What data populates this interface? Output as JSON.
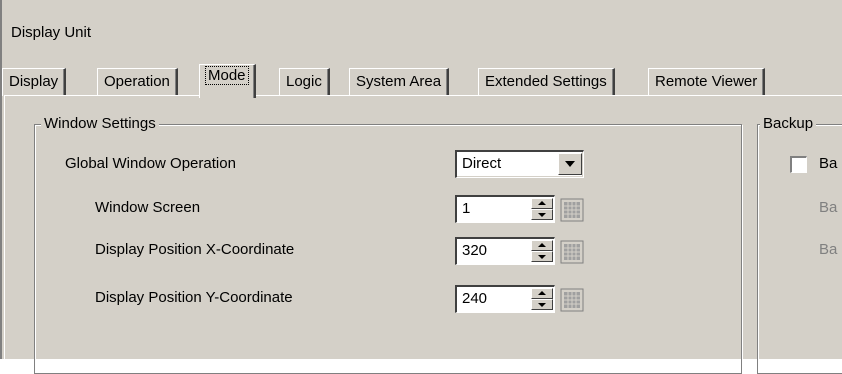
{
  "window": {
    "title": "Display Unit"
  },
  "tabs": [
    {
      "label": "Display"
    },
    {
      "label": "Operation"
    },
    {
      "label": "Mode"
    },
    {
      "label": "Logic"
    },
    {
      "label": "System Area"
    },
    {
      "label": "Extended Settings"
    },
    {
      "label": "Remote Viewer"
    }
  ],
  "window_settings": {
    "group_title": "Window Settings",
    "global_operation": {
      "label": "Global Window Operation",
      "value": "Direct"
    },
    "window_screen": {
      "label": "Window Screen",
      "value": "1"
    },
    "x_coord": {
      "label": "Display Position X-Coordinate",
      "value": "320"
    },
    "y_coord": {
      "label": "Display Position Y-Coordinate",
      "value": "240"
    }
  },
  "backup": {
    "group_title": "Backup",
    "checkbox_label": "Ba",
    "line1": "Ba",
    "line2": "Ba"
  }
}
